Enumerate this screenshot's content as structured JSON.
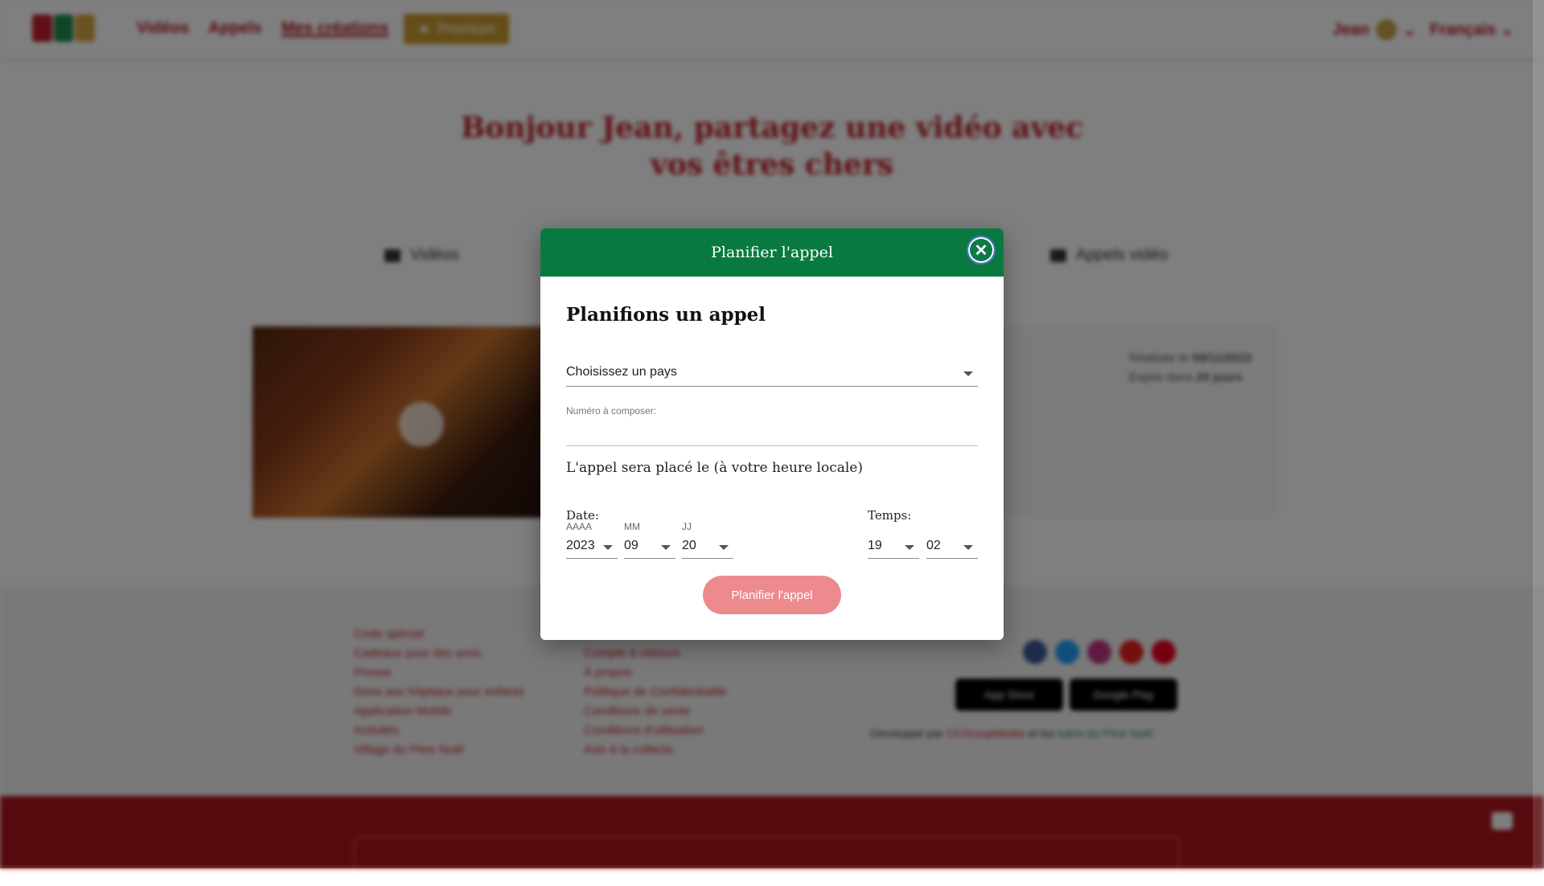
{
  "background_page": {
    "nav": {
      "items": [
        "Vidéos",
        "Appels",
        "Mes créations"
      ],
      "premium_label": "Premium",
      "user_name": "Jean",
      "language": "Français"
    },
    "headline": "Bonjour Jean, partagez une vidéo avec vos êtres chers",
    "tabs": [
      "Vidéos",
      "Appels vidéo"
    ],
    "creation_card": {
      "published_label": "Réalisée le",
      "published_date": "09/11/2023",
      "expires_label": "Expire dans",
      "expires_value": "20 jours"
    },
    "footer": {
      "col1": [
        "Code spécial",
        "Cadeaux pour des amis",
        "Presse",
        "Dons aux hôpitaux pour enfants",
        "Application Mobile",
        "Activités",
        "Village du Père Noël"
      ],
      "col2": [
        "Compte à rebours",
        "À propos",
        "Politique de Confidentialité",
        "Conditions de vente",
        "Conditions d'utilisation",
        "Avis à la collecte"
      ],
      "credit_prefix": "Développé par",
      "credit_company": "CCGroupMedia",
      "credit_and": "et les",
      "credit_elves": "lutins du Père Noël",
      "app_store": "App Store",
      "google_play": "Google Play"
    }
  },
  "modal": {
    "title": "Planifier l'appel",
    "close_symbol": "✕",
    "heading": "Planifions un appel",
    "country_placeholder": "Choisissez un pays",
    "number_label": "Numéro à composer:",
    "number_value": "",
    "schedule_text": "L'appel sera placé le (à votre heure locale)",
    "date_label": "Date:",
    "time_label": "Temps:",
    "year_label": "AAAA",
    "month_label": "MM",
    "day_label": "JJ",
    "year": "2023",
    "month": "09",
    "day": "20",
    "hour": "19",
    "minute": "02",
    "submit_label": "Planifier l'appel"
  },
  "colors": {
    "modal_header": "#097a3f",
    "submit_button": "#ec8a8d",
    "brand_red": "#c0202a"
  }
}
